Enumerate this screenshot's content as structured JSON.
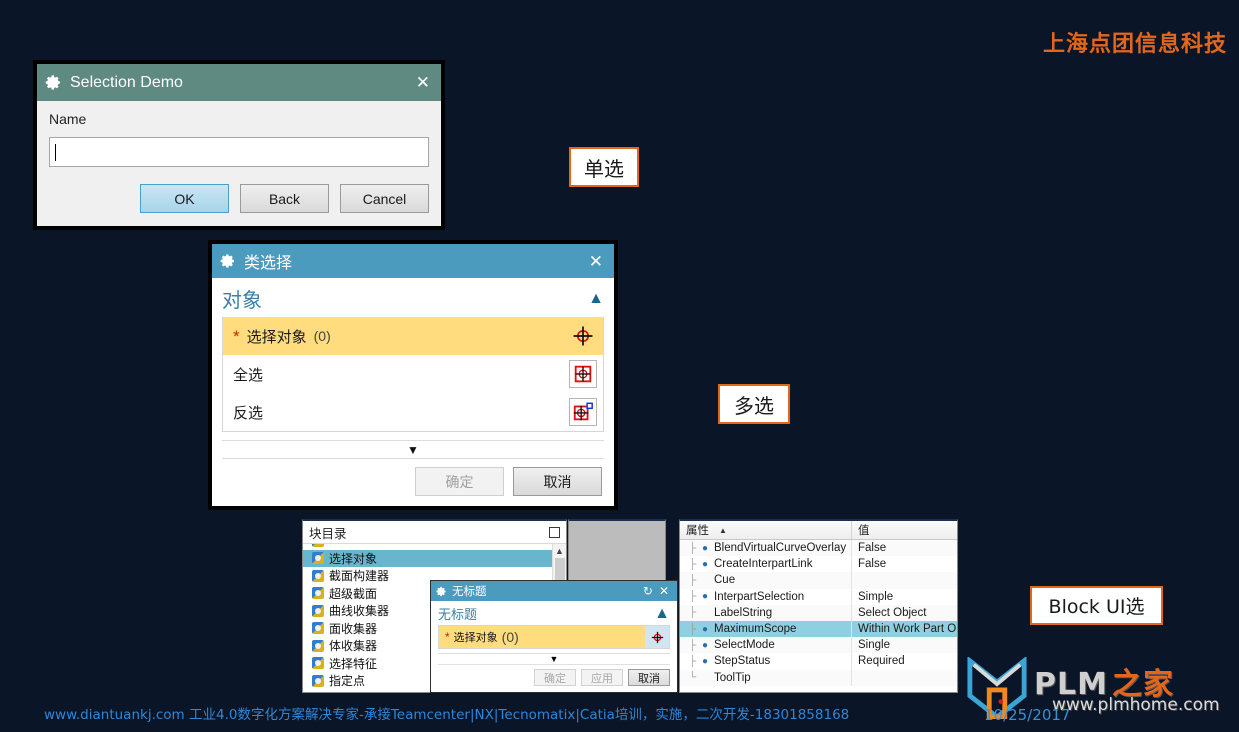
{
  "branding": {
    "top_right": "上海点团信息科技",
    "footer": "www.diantuankj.com 工业4.0数字化方案解决专家-承接Teamcenter|NX|Tecnomatix|Catia培训，实施，二次开发-18301858168",
    "date": "10/25/2017",
    "logo_text": "PLM",
    "logo_text_cn": "之家",
    "logo_url": "www.plmhome.com",
    "accent_orange": "#e4661a",
    "footer_blue": "#2e86d8",
    "background": "#0a1628"
  },
  "callouts": {
    "single": "单选",
    "multi": "多选",
    "block_ui": "Block UI选"
  },
  "selection_demo": {
    "title": "Selection Demo",
    "titlebar_color": "#5e8a81",
    "gear_icon": "gear-icon",
    "close_icon": "close-icon",
    "field_label": "Name",
    "field_value": "",
    "field_placeholder": "",
    "buttons": {
      "ok": "OK",
      "back": "Back",
      "cancel": "Cancel"
    }
  },
  "class_select": {
    "title": "类选择",
    "titlebar_color": "#4a9bbd",
    "gear_icon": "gear-icon",
    "close_icon": "close-icon",
    "group_label": "对象",
    "collapse_icon": "chevron-up-icon",
    "rows": [
      {
        "required": "*",
        "label": "选择对象",
        "count": "(0)",
        "icon": "select-object-icon",
        "active": true
      },
      {
        "required": "",
        "label": "全选",
        "count": "",
        "icon": "select-all-icon",
        "active": false
      },
      {
        "required": "",
        "label": "反选",
        "count": "",
        "icon": "invert-selection-icon",
        "active": false
      }
    ],
    "expand_icon": "chevron-down-icon",
    "buttons": {
      "ok": "确定",
      "cancel": "取消"
    }
  },
  "block_catalog": {
    "title": "块目录",
    "maximize_icon": "maximize-icon",
    "scroll_up_icon": "scroll-up-arrow",
    "items": [
      {
        "label": "选择对象",
        "selected": true
      },
      {
        "label": "截面构建器",
        "selected": false
      },
      {
        "label": "超级截面",
        "selected": false
      },
      {
        "label": "曲线收集器",
        "selected": false
      },
      {
        "label": "面收集器",
        "selected": false
      },
      {
        "label": "体收集器",
        "selected": false
      },
      {
        "label": "选择特征",
        "selected": false
      },
      {
        "label": "指定点",
        "selected": false
      }
    ]
  },
  "untitled_dialog": {
    "title": "无标题",
    "titlebar_color": "#4a9bbd",
    "gear_icon": "gear-icon",
    "reset_icon": "reset-icon",
    "close_icon": "close-icon",
    "group_label": "无标题",
    "collapse_icon": "chevron-up-icon",
    "row": {
      "required": "*",
      "label": "选择对象",
      "count": "(0)",
      "icon": "select-object-icon"
    },
    "expand_icon": "chevron-down-icon",
    "buttons": {
      "ok": "确定",
      "apply": "应用",
      "cancel": "取消"
    }
  },
  "properties": {
    "columns": [
      "属性",
      "值"
    ],
    "sort_icon": "sort-ascending-icon",
    "rows": [
      {
        "name": "BlendVirtualCurveOverlay",
        "value": "False",
        "has_dot": true,
        "selected": false
      },
      {
        "name": "CreateInterpartLink",
        "value": "False",
        "has_dot": true,
        "selected": false
      },
      {
        "name": "Cue",
        "value": "",
        "has_dot": false,
        "selected": false
      },
      {
        "name": "InterpartSelection",
        "value": "Simple",
        "has_dot": true,
        "selected": false
      },
      {
        "name": "LabelString",
        "value": "Select Object",
        "has_dot": false,
        "selected": false
      },
      {
        "name": "MaximumScope",
        "value": "Within Work Part Only",
        "has_dot": true,
        "selected": true
      },
      {
        "name": "SelectMode",
        "value": "Single",
        "has_dot": true,
        "selected": false
      },
      {
        "name": "StepStatus",
        "value": "Required",
        "has_dot": true,
        "selected": false
      },
      {
        "name": "ToolTip",
        "value": "",
        "has_dot": false,
        "selected": false
      }
    ]
  }
}
